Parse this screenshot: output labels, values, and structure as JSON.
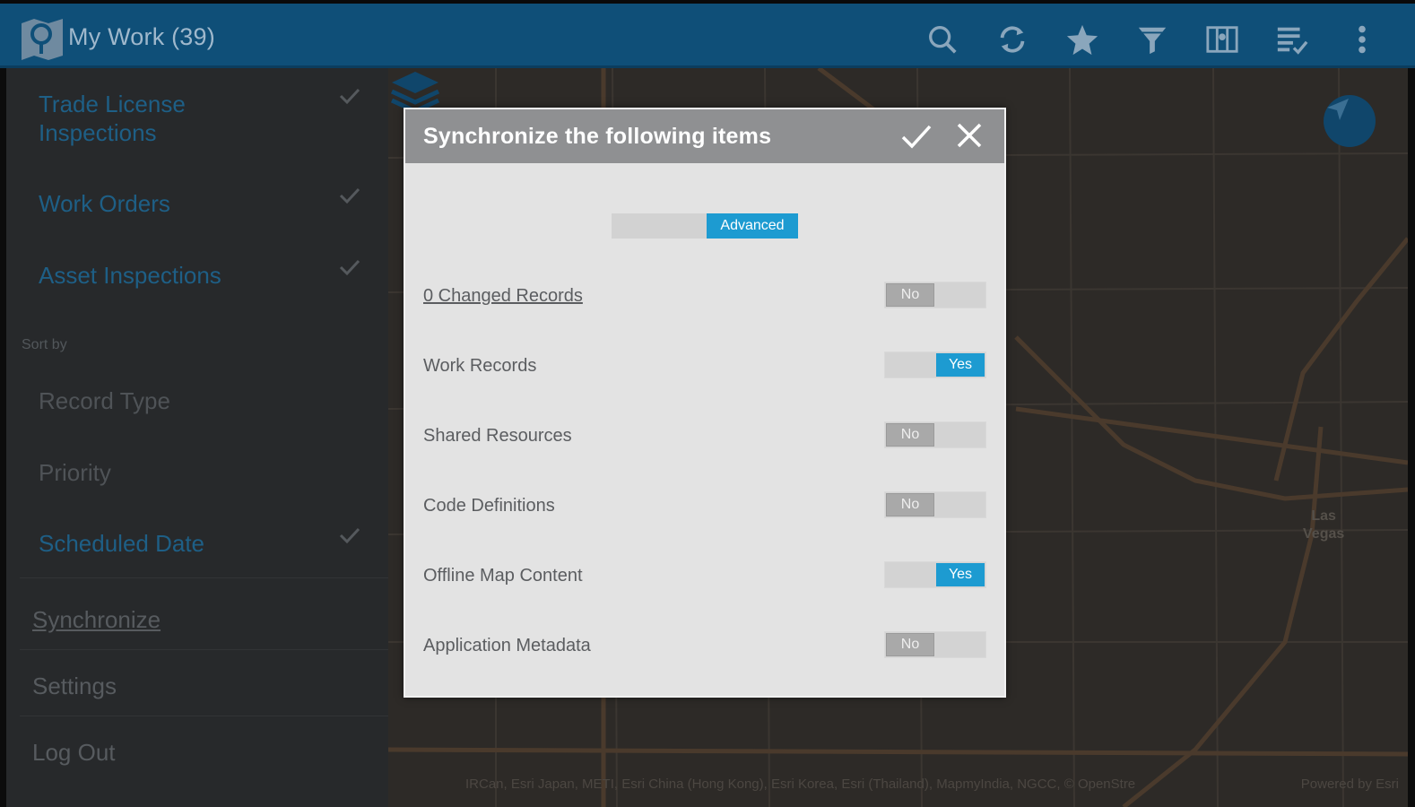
{
  "appbar": {
    "title": "My Work (39)",
    "actions": [
      "search-icon",
      "refresh-icon",
      "star-icon",
      "filter-icon",
      "map-view-icon",
      "checklist-icon",
      "more-vert-icon"
    ],
    "color": "#0f4f78"
  },
  "drawer": {
    "record_types": [
      {
        "label": "Trade License\nInspections",
        "checked": true
      },
      {
        "label": "Work Orders",
        "checked": true
      },
      {
        "label": "Asset Inspections",
        "checked": true
      }
    ],
    "sort_by_label": "Sort by",
    "sort_options": [
      {
        "label": "Record Type",
        "checked": false
      },
      {
        "label": "Priority",
        "checked": false
      },
      {
        "label": "Scheduled Date",
        "checked": true
      }
    ],
    "links": {
      "synchronize": "Synchronize",
      "settings": "Settings",
      "logout": "Log Out"
    }
  },
  "map": {
    "attribution": "IRCan, Esri Japan, METI, Esri China (Hong Kong), Esri Korea, Esri (Thailand), MapmyIndia, NGCC, © OpenStre",
    "powered_by": "Powered by Esri",
    "city_label": "Las\nVegas"
  },
  "dialog": {
    "title": "Synchronize the following items",
    "mode": {
      "selected": "Advanced"
    },
    "items": [
      {
        "label": "0 Changed Records",
        "value": "No",
        "link": true
      },
      {
        "label": "Work Records",
        "value": "Yes",
        "link": false
      },
      {
        "label": "Shared Resources",
        "value": "No",
        "link": false
      },
      {
        "label": "Code Definitions",
        "value": "No",
        "link": false
      },
      {
        "label": "Offline Map Content",
        "value": "Yes",
        "link": false
      },
      {
        "label": "Application Metadata",
        "value": "No",
        "link": false
      }
    ],
    "accent": "#1d9bd1"
  }
}
